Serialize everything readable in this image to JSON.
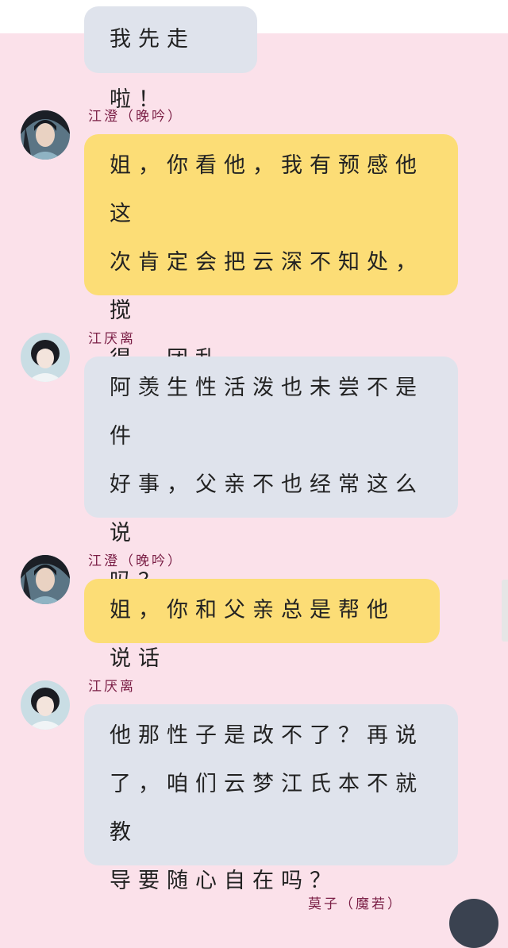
{
  "messages": [
    {
      "sender": "",
      "style": "gray",
      "lines": [
        "我先走啦！"
      ]
    },
    {
      "sender": "江澄（晚吟）",
      "style": "yellow",
      "avatar": "male-avatar",
      "lines": [
        "姐，你看他，我有预感他这",
        "次肯定会把云深不知处，搅",
        "得一团乱"
      ]
    },
    {
      "sender": "江厌离",
      "style": "gray",
      "avatar": "female-avatar",
      "lines": [
        "阿羡生性活泼也未尝不是件",
        "好事，父亲不也经常这么说",
        "吗？"
      ]
    },
    {
      "sender": "江澄（晚吟）",
      "style": "yellow",
      "avatar": "male-avatar",
      "lines": [
        "姐，你和父亲总是帮他说话"
      ]
    },
    {
      "sender": "江厌离",
      "style": "gray",
      "avatar": "female-avatar",
      "lines": [
        "他那性子是改不了？再说",
        "了，咱们云梦江氏本不就教",
        "导要随心自在吗？"
      ]
    },
    {
      "sender": "莫子（魔若）",
      "style": "",
      "lines": []
    }
  ],
  "colors": {
    "background": "#fbe1ea",
    "bubble_gray": "#dfe3ec",
    "bubble_yellow": "#fcdd76",
    "sender_name": "#7a1e45"
  }
}
